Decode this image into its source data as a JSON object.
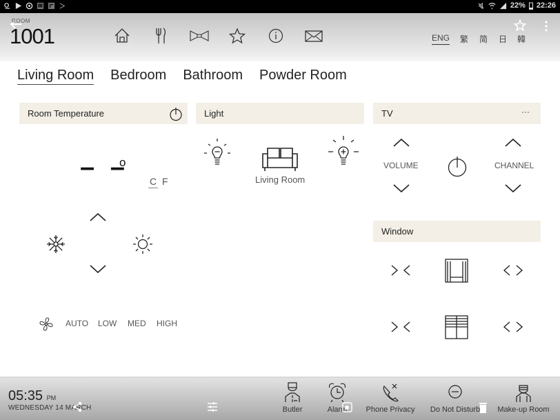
{
  "status_bar": {
    "battery": "22%",
    "time": "22:26",
    "left_icons": [
      "weather-icon",
      "play-icon",
      "sync-icon",
      "image-icon",
      "flipboard-icon",
      "cast-icon"
    ],
    "right_icons": [
      "mute-icon",
      "wifi-icon",
      "signal-icon",
      "battery-icon"
    ]
  },
  "header": {
    "room_label": "ROOM",
    "room_number": "1001",
    "nav_icons": [
      "home-icon",
      "dining-icon",
      "bowtie-icon",
      "star-icon",
      "info-icon",
      "mail-icon"
    ],
    "languages": [
      "ENG",
      "繁",
      "简",
      "日",
      "韓"
    ],
    "active_language": "ENG"
  },
  "tabs": [
    {
      "label": "Living Room",
      "active": true
    },
    {
      "label": "Bedroom",
      "active": false
    },
    {
      "label": "Bathroom",
      "active": false
    },
    {
      "label": "Powder Room",
      "active": false
    }
  ],
  "room_temperature": {
    "title": "Room Temperature",
    "value": "– –",
    "degree": "o",
    "unit_c": "C",
    "unit_f": "F",
    "active_unit": "C",
    "fan_speeds": [
      "AUTO",
      "LOW",
      "MED",
      "HIGH"
    ]
  },
  "light": {
    "title": "Light",
    "zone_label": "Living Room"
  },
  "tv": {
    "title": "TV",
    "more": "···",
    "volume_label": "VOLUME",
    "channel_label": "CHANNEL"
  },
  "window": {
    "title": "Window"
  },
  "footer": {
    "time": "05:35",
    "ampm": "PM",
    "date": "WEDNESDAY 14 MARCH",
    "items": [
      {
        "label": "Butler",
        "icon": "butler-icon"
      },
      {
        "label": "Alarm",
        "icon": "alarm-clock-icon"
      },
      {
        "label": "Phone Privacy",
        "icon": "phone-privacy-icon"
      },
      {
        "label": "Do Not Disturb",
        "icon": "do-not-disturb-icon"
      },
      {
        "label": "Make-up Room",
        "icon": "makeup-room-icon"
      }
    ]
  }
}
